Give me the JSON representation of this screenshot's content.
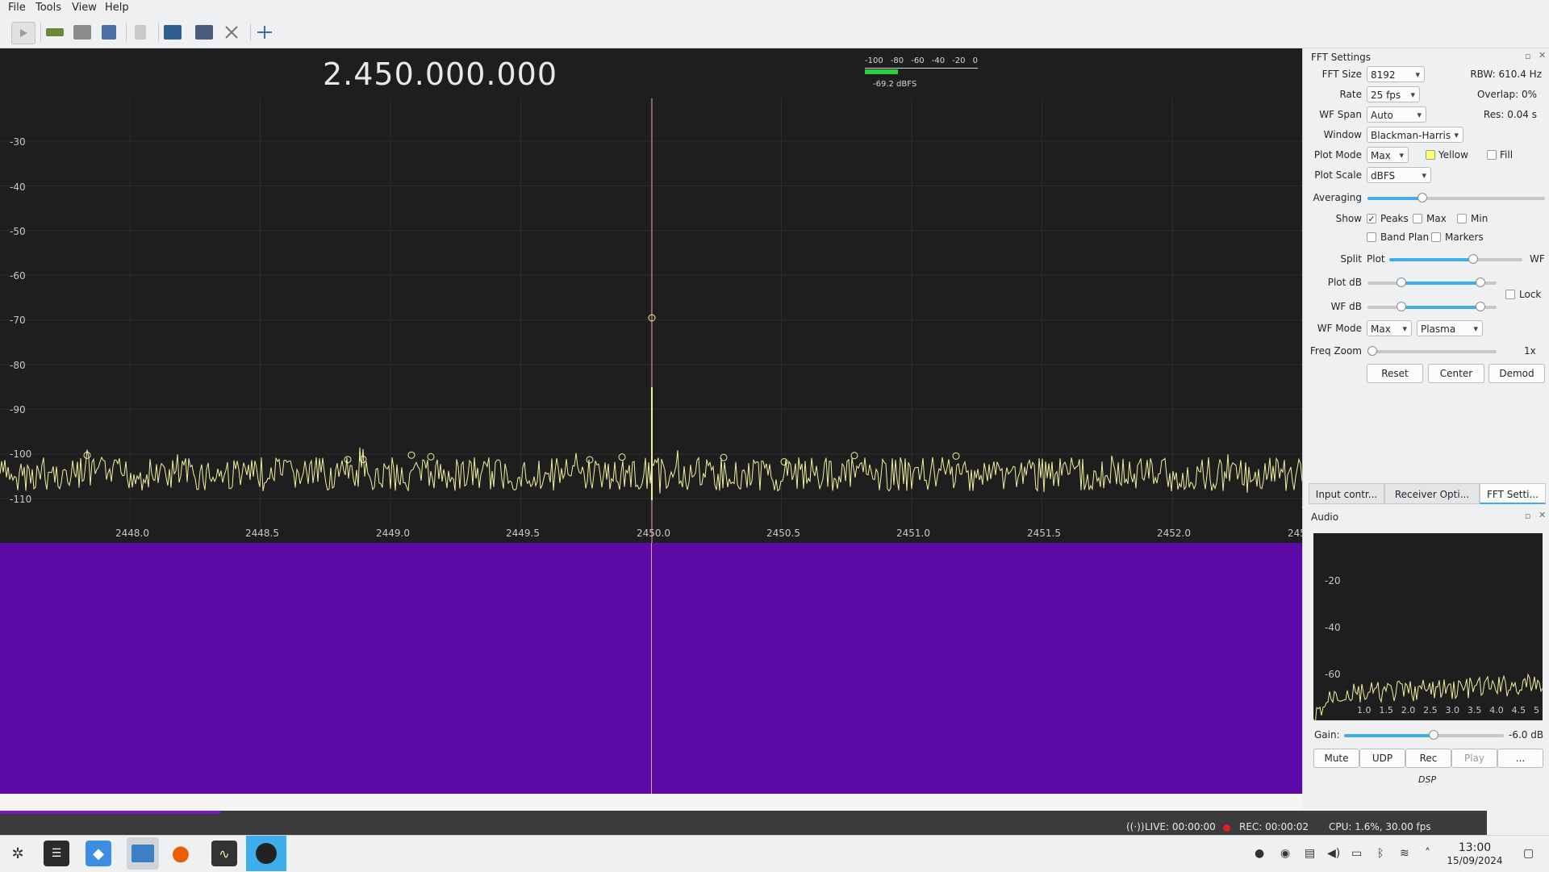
{
  "menu": [
    "File",
    "Tools",
    "View",
    "Help"
  ],
  "toolbar": {
    "icons": [
      "play-icon",
      "hardware-icon",
      "open-folder-icon",
      "save-icon",
      "bookmark-icon",
      "config-icon",
      "screenshot-icon",
      "tools-icon",
      "fit-icon"
    ]
  },
  "frequency": "2.450.000.000",
  "signal_meter": {
    "ticks": [
      "-100",
      "-80",
      "-60",
      "-40",
      "-20",
      "0"
    ],
    "level": "-69.2 dBFS",
    "level_fraction": 0.29
  },
  "plot": {
    "y_ticks": [
      "-30",
      "-40",
      "-50",
      "-60",
      "-70",
      "-80",
      "-90",
      "-100",
      "-110"
    ],
    "x_ticks": [
      "2448.0",
      "2448.5",
      "2449.0",
      "2449.5",
      "2450.0",
      "2450.5",
      "2451.0",
      "2451.5",
      "2452.0",
      "245"
    ],
    "trace_color": "#f0f0a0",
    "waterfall_color": "#5c0aa8"
  },
  "fft": {
    "title": "FFT Settings",
    "fft_size_label": "FFT Size",
    "fft_size": "8192",
    "rbw": "RBW: 610.4 Hz",
    "rate_label": "Rate",
    "rate": "25 fps",
    "overlap": "Overlap: 0%",
    "wf_span_label": "WF Span",
    "wf_span": "Auto",
    "res": "Res: 0.04 s",
    "window_label": "Window",
    "window": "Blackman-Harris",
    "plot_mode_label": "Plot Mode",
    "plot_mode": "Max",
    "yellow": "Yellow",
    "fill": "Fill",
    "plot_scale_label": "Plot Scale",
    "plot_scale": "dBFS",
    "averaging_label": "Averaging",
    "averaging": 0.31,
    "show_label": "Show",
    "peaks": "Peaks",
    "max": "Max",
    "min": "Min",
    "band_plan": "Band Plan",
    "markers": "Markers",
    "split_label": "Split",
    "split_left": "Plot",
    "split_right": "WF",
    "split": 0.63,
    "plot_db_label": "Plot dB",
    "lock": "Lock",
    "wf_db_label": "WF dB",
    "wf_mode_label": "WF Mode",
    "wf_mode": "Max",
    "wf_palette": "Plasma",
    "freq_zoom_label": "Freq Zoom",
    "freq_zoom": "1x",
    "reset": "Reset",
    "center": "Center",
    "demod": "Demod"
  },
  "tabs": [
    "Input contr...",
    "Receiver Opti...",
    "FFT Setti..."
  ],
  "audio": {
    "title": "Audio",
    "y_ticks": [
      "-20",
      "-40",
      "-60"
    ],
    "x_ticks": [
      "1.0",
      "1.5",
      "2.0",
      "2.5",
      "3.0",
      "3.5",
      "4.0",
      "4.5",
      "5"
    ],
    "gain_label": "Gain:",
    "gain": "-6.0 dB",
    "gain_fraction": 0.56,
    "buttons": [
      "Mute",
      "UDP",
      "Rec",
      "Play",
      "..."
    ],
    "dsp": "DSP"
  },
  "status": {
    "live": "LIVE: 00:00:00",
    "rec": "REC: 00:00:02",
    "cpu": "CPU: 1.6%, 30.00 fps"
  },
  "clock": {
    "time": "13:00",
    "date": "15/09/2024"
  }
}
